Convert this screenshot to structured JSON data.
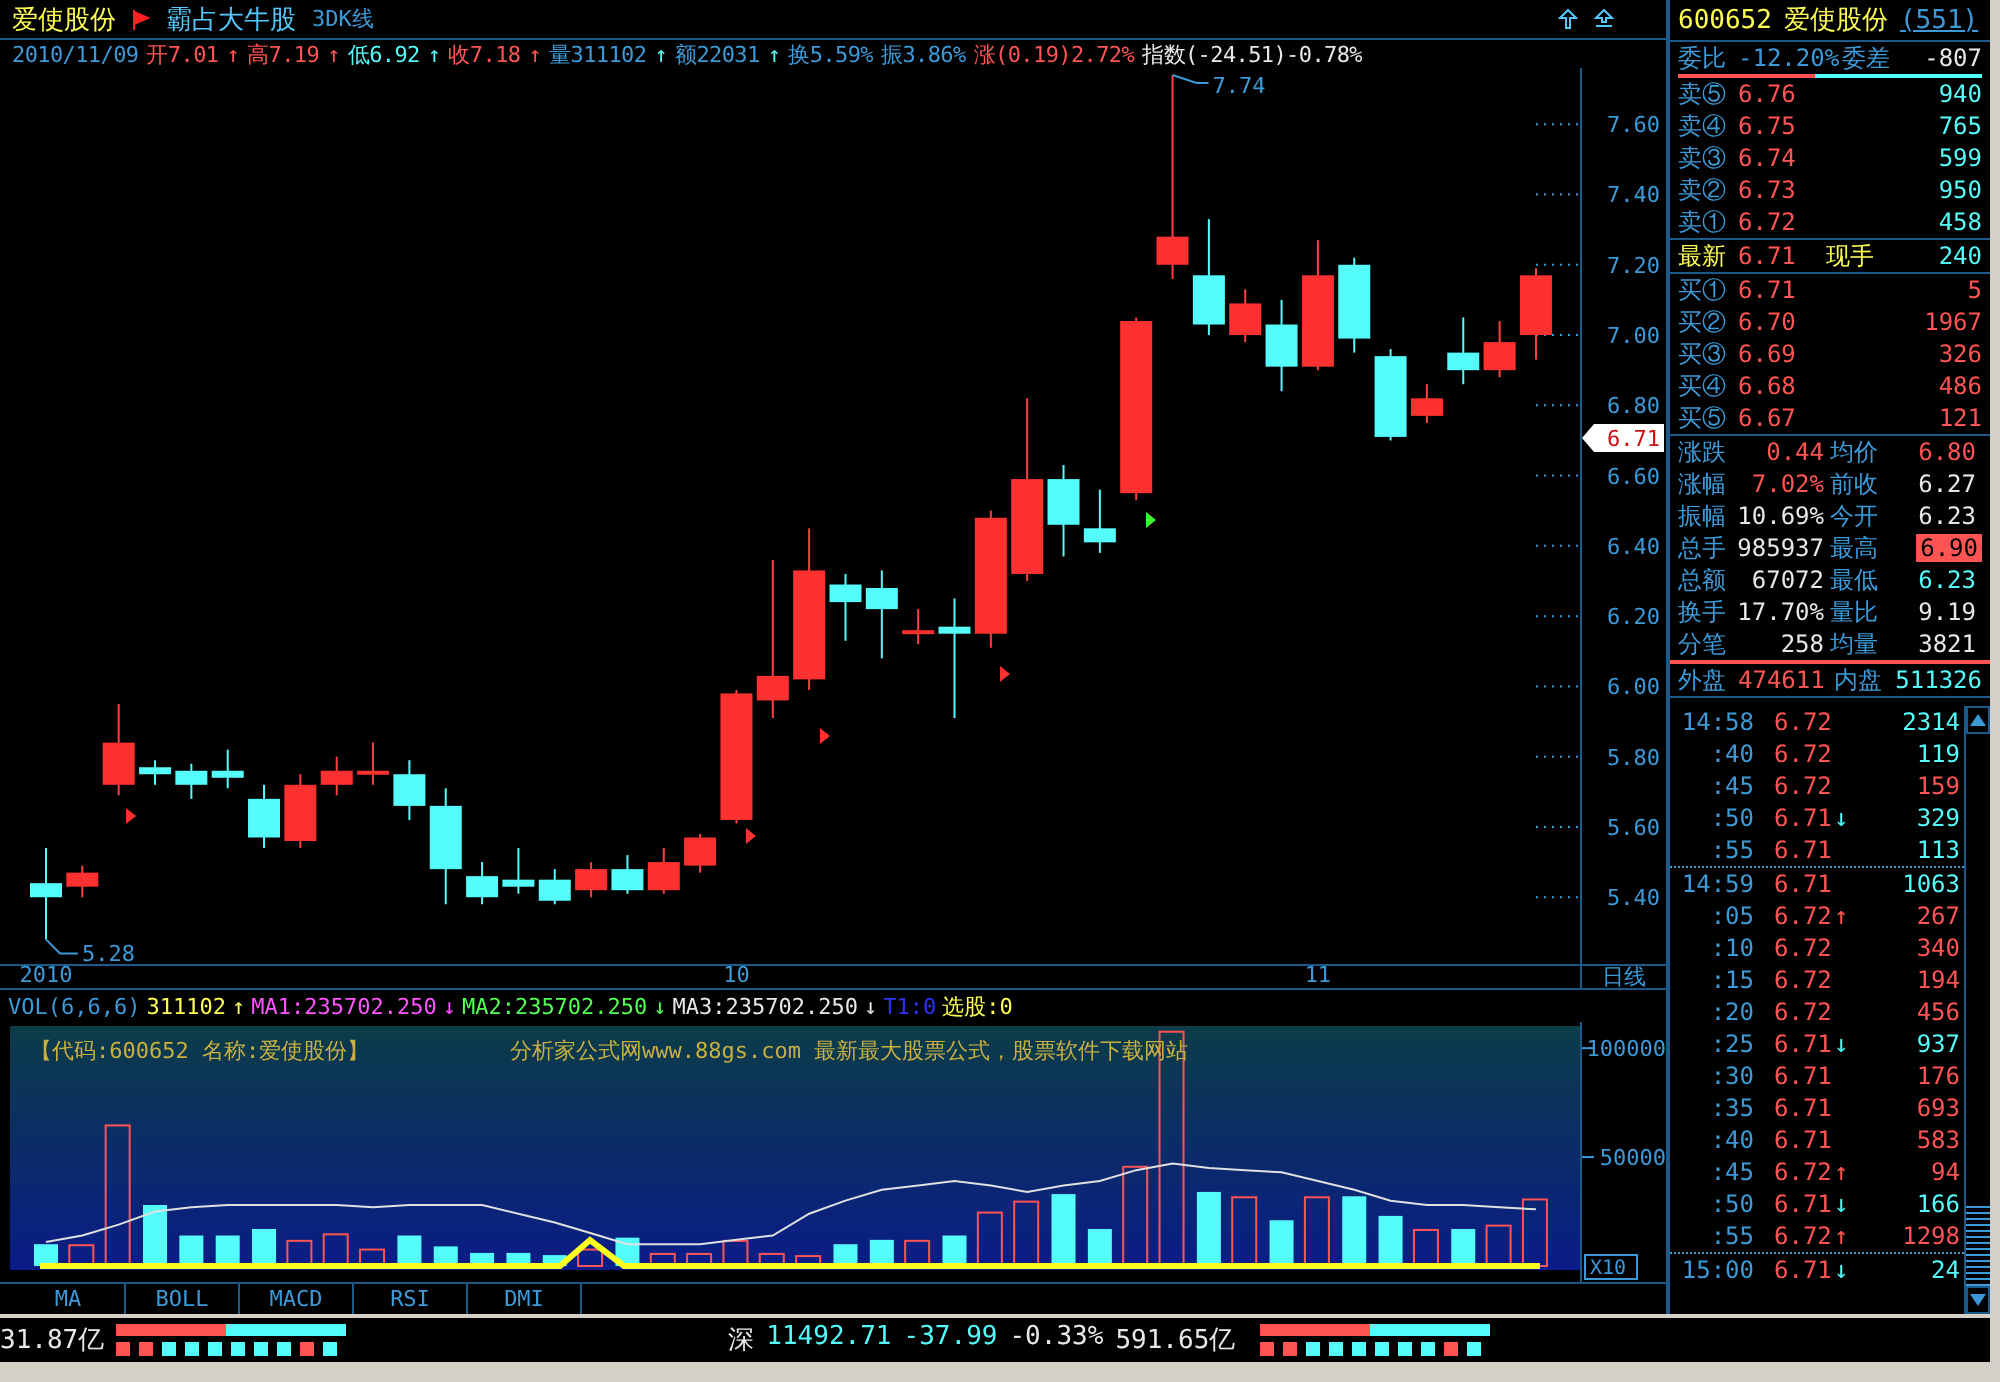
{
  "header": {
    "stock_name": "爱使股份",
    "formula": "霸占大牛股",
    "view": "3DK线"
  },
  "quote_line": [
    {
      "text": "2010/11/09",
      "color": "#3c9ad8"
    },
    {
      "text": "开7.01",
      "color": "#ff5454"
    },
    {
      "text": "↑",
      "color": "#ff5454"
    },
    {
      "text": "高7.19",
      "color": "#ff5454"
    },
    {
      "text": "↑",
      "color": "#ff5454"
    },
    {
      "text": "低6.92",
      "color": "#54fcfc"
    },
    {
      "text": "↑",
      "color": "#54fcfc"
    },
    {
      "text": "收7.18",
      "color": "#ff5454"
    },
    {
      "text": "↑",
      "color": "#ff5454"
    },
    {
      "text": "量311102",
      "color": "#3c9ad8"
    },
    {
      "text": "↑",
      "color": "#54fcfc"
    },
    {
      "text": "额22031",
      "color": "#3c9ad8"
    },
    {
      "text": "↑",
      "color": "#54fcfc"
    },
    {
      "text": "换5.59%",
      "color": "#3c9ad8"
    },
    {
      "text": "振3.86%",
      "color": "#3c9ad8"
    },
    {
      "text": "涨(0.19)2.72%",
      "color": "#ff5454"
    },
    {
      "text": "指数(-24.51)-0.78%",
      "color": "#e8e8e8"
    }
  ],
  "price_chart": {
    "high_label": "7.74",
    "low_label": "5.28",
    "current_price": "6.71",
    "chart_data": {
      "type": "candlestick",
      "categories": [
        "2010",
        null,
        null,
        null,
        null,
        null,
        null,
        null,
        null,
        null,
        null,
        null,
        null,
        null,
        null,
        null,
        null,
        null,
        null,
        "10",
        null,
        null,
        null,
        null,
        null,
        null,
        null,
        null,
        null,
        null,
        null,
        null,
        null,
        null,
        null,
        "11",
        null,
        null,
        null,
        null,
        null,
        null
      ],
      "ohlc": [
        [
          5.44,
          5.54,
          5.28,
          5.4
        ],
        [
          5.43,
          5.49,
          5.4,
          5.47
        ],
        [
          5.72,
          5.95,
          5.69,
          5.84
        ],
        [
          5.77,
          5.79,
          5.72,
          5.75
        ],
        [
          5.76,
          5.78,
          5.68,
          5.72
        ],
        [
          5.76,
          5.82,
          5.71,
          5.74
        ],
        [
          5.68,
          5.72,
          5.54,
          5.57
        ],
        [
          5.56,
          5.75,
          5.54,
          5.72
        ],
        [
          5.72,
          5.8,
          5.69,
          5.76
        ],
        [
          5.75,
          5.84,
          5.72,
          5.76
        ],
        [
          5.75,
          5.79,
          5.62,
          5.66
        ],
        [
          5.66,
          5.71,
          5.38,
          5.48
        ],
        [
          5.46,
          5.5,
          5.38,
          5.4
        ],
        [
          5.45,
          5.54,
          5.41,
          5.43
        ],
        [
          5.45,
          5.48,
          5.38,
          5.39
        ],
        [
          5.42,
          5.5,
          5.4,
          5.48
        ],
        [
          5.48,
          5.52,
          5.41,
          5.42
        ],
        [
          5.42,
          5.54,
          5.41,
          5.5
        ],
        [
          5.49,
          5.58,
          5.47,
          5.57
        ],
        [
          5.62,
          5.99,
          5.61,
          5.98
        ],
        [
          5.96,
          6.36,
          5.91,
          6.03
        ],
        [
          6.02,
          6.45,
          5.99,
          6.33
        ],
        [
          6.29,
          6.32,
          6.13,
          6.24
        ],
        [
          6.28,
          6.33,
          6.08,
          6.22
        ],
        [
          6.15,
          6.22,
          6.12,
          6.16
        ],
        [
          6.17,
          6.25,
          5.91,
          6.15
        ],
        [
          6.15,
          6.5,
          6.11,
          6.48
        ],
        [
          6.32,
          6.82,
          6.3,
          6.59
        ],
        [
          6.59,
          6.63,
          6.37,
          6.46
        ],
        [
          6.45,
          6.56,
          6.38,
          6.41
        ],
        [
          6.55,
          7.05,
          6.53,
          7.04
        ],
        [
          7.2,
          7.74,
          7.16,
          7.28
        ],
        [
          7.17,
          7.33,
          7.0,
          7.03
        ],
        [
          7.0,
          7.13,
          6.98,
          7.09
        ],
        [
          7.03,
          7.1,
          6.84,
          6.91
        ],
        [
          6.91,
          7.27,
          6.9,
          7.17
        ],
        [
          7.2,
          7.22,
          6.95,
          6.99
        ],
        [
          6.94,
          6.96,
          6.7,
          6.71
        ],
        [
          6.77,
          6.86,
          6.75,
          6.82
        ],
        [
          6.95,
          7.05,
          6.86,
          6.9
        ],
        [
          6.9,
          7.04,
          6.88,
          6.98
        ],
        [
          7.0,
          7.19,
          6.93,
          7.17
        ]
      ],
      "ylim": [
        5.21,
        7.76
      ],
      "yticks": [
        {
          "value": 7.6,
          "label": "7.60"
        },
        {
          "value": 7.4,
          "label": "7.40"
        },
        {
          "value": 7.2,
          "label": "7.20"
        },
        {
          "value": 7.0,
          "label": "7.00"
        },
        {
          "value": 6.8,
          "label": "6.80"
        },
        {
          "value": 6.6,
          "label": "6.60"
        },
        {
          "value": 6.4,
          "label": "6.40"
        },
        {
          "value": 6.2,
          "label": "6.20"
        },
        {
          "value": 6.0,
          "label": "6.00"
        },
        {
          "value": 5.8,
          "label": "5.80"
        },
        {
          "value": 5.6,
          "label": "5.60"
        },
        {
          "value": 5.4,
          "label": "5.40"
        }
      ]
    }
  },
  "x_axis": {
    "period": "日线"
  },
  "indicator_line": [
    {
      "text": "311102",
      "color": "#ffff54"
    },
    {
      "text": "↑",
      "color": "#ffff54"
    },
    {
      "text": "MA1:235702.250",
      "color": "#ff54ff"
    },
    {
      "text": "↓",
      "color": "#ff54ff"
    },
    {
      "text": "MA2:235702.250",
      "color": "#54ff54"
    },
    {
      "text": "↓",
      "color": "#54ff54"
    },
    {
      "text": "MA3:235702.250",
      "color": "#e8e8e8"
    },
    {
      "text": "↓",
      "color": "#e8e8e8"
    },
    {
      "text": "T1:0",
      "color": "#3030ff"
    },
    {
      "text": "选股:0",
      "color": "#ffff54"
    }
  ],
  "volume_panel": {
    "caption": "【代码:600652 名称:爱使股份】",
    "notice": "分析家公式网www.88gs.com 最新最大股票公式，股票软件下载网站",
    "scale": "X10",
    "chart_data": {
      "type": "bar",
      "categories": [
        null,
        null,
        null,
        null,
        null,
        null,
        null,
        null,
        null,
        null,
        null,
        null,
        null,
        null,
        null,
        null,
        null,
        null,
        null,
        null,
        null,
        null,
        null,
        null,
        null,
        null,
        null,
        null,
        null,
        null,
        null,
        null,
        null,
        null,
        null,
        null,
        null,
        null,
        null,
        null,
        null,
        null
      ],
      "series": [
        {
          "name": "VOL(6,6,6)",
          "colors": [
            "#54fcfc",
            "#ff5454",
            "#ff5454",
            "#54fcfc",
            "#54fcfc",
            "#54fcfc",
            "#54fcfc",
            "#ff5454",
            "#ff5454",
            "#ff5454",
            "#54fcfc",
            "#54fcfc",
            "#54fcfc",
            "#54fcfc",
            "#54fcfc",
            "#ff5454",
            "#54fcfc",
            "#ff5454",
            "#ff5454",
            "#ff5454",
            "#ff5454",
            "#ff5454",
            "#54fcfc",
            "#54fcfc",
            "#ff5454",
            "#54fcfc",
            "#ff5454",
            "#ff5454",
            "#54fcfc",
            "#54fcfc",
            "#ff5454",
            "#ff5454",
            "#54fcfc",
            "#ff5454",
            "#54fcfc",
            "#ff5454",
            "#54fcfc",
            "#54fcfc",
            "#ff5454",
            "#54fcfc",
            "#ff5454",
            "#ff5454"
          ],
          "values": [
            10000,
            10000,
            65000,
            28000,
            14000,
            14000,
            17000,
            12000,
            15000,
            8000,
            14000,
            9000,
            6000,
            6000,
            5000,
            8000,
            13000,
            6000,
            6000,
            12000,
            6000,
            5000,
            10000,
            12000,
            12000,
            14000,
            25000,
            30000,
            33000,
            17000,
            46000,
            108000,
            34000,
            32000,
            21000,
            32000,
            32000,
            23000,
            17000,
            17000,
            19000,
            31000
          ]
        },
        {
          "type": "line",
          "values": [
            11000,
            14000,
            19000,
            25000,
            27000,
            28000,
            28000,
            28000,
            28000,
            27000,
            28000,
            28000,
            28000,
            24000,
            20000,
            15000,
            10000,
            10000,
            10000,
            12000,
            14000,
            24000,
            30000,
            35000,
            37000,
            39000,
            37000,
            34000,
            37000,
            39000,
            44000,
            47000,
            45000,
            44000,
            43000,
            39000,
            35000,
            30000,
            28000,
            28000,
            27000,
            26000
          ]
        }
      ],
      "ylim": [
        0,
        112000
      ],
      "yticks": [
        {
          "value": 100000,
          "label": "100000"
        },
        {
          "value": 50000,
          "label": "50000"
        }
      ]
    }
  },
  "indicator_tabs": [
    {
      "label": "MA"
    },
    {
      "label": "BOLL"
    },
    {
      "label": "MACD"
    },
    {
      "label": "RSI"
    },
    {
      "label": "DMI"
    }
  ],
  "status_bar": {
    "left_amount": "31.87亿",
    "market": "深",
    "index": "11492.71",
    "change": "-37.99",
    "percent": "-0.33%",
    "amount": "591.65亿"
  },
  "quote_panel": {
    "code": "600652",
    "name": "爱使股份",
    "count": "(551)",
    "ratio_label": "委比",
    "ratio": "-12.20%",
    "diff_label": "委差",
    "diff": "-807",
    "asks": [
      {
        "label": "卖⑤",
        "price": "6.76",
        "volume": "940"
      },
      {
        "label": "卖④",
        "price": "6.75",
        "volume": "765"
      },
      {
        "label": "卖③",
        "price": "6.74",
        "volume": "599"
      },
      {
        "label": "卖②",
        "price": "6.73",
        "volume": "950"
      },
      {
        "label": "卖①",
        "price": "6.72",
        "volume": "458"
      }
    ],
    "last": {
      "label": "最新",
      "price": "6.71",
      "hand_label": "现手",
      "hand": "240"
    },
    "bids": [
      {
        "label": "买①",
        "price": "6.71",
        "volume": "5"
      },
      {
        "label": "买②",
        "price": "6.70",
        "volume": "1967"
      },
      {
        "label": "买③",
        "price": "6.69",
        "volume": "326"
      },
      {
        "label": "买④",
        "price": "6.68",
        "volume": "486"
      },
      {
        "label": "买⑤",
        "price": "6.67",
        "volume": "121"
      }
    ],
    "stats": [
      {
        "label": "涨跌",
        "value": "0.44",
        "color": "#ff5454",
        "highlight": false
      },
      {
        "label": "均价",
        "value": "6.80",
        "color": "#ff5454",
        "highlight": false
      },
      {
        "label": "涨幅",
        "value": "7.02%",
        "color": "#ff5454",
        "highlight": false
      },
      {
        "label": "前收",
        "value": "6.27",
        "color": "#e8e8e8",
        "highlight": false
      },
      {
        "label": "振幅",
        "value": "10.69%",
        "color": "#e8e8e8",
        "highlight": false
      },
      {
        "label": "今开",
        "value": "6.23",
        "color": "#e8e8e8",
        "highlight": false
      },
      {
        "label": "总手",
        "value": "985937",
        "color": "#e8e8e8",
        "highlight": false
      },
      {
        "label": "最高",
        "value": "6.90",
        "color": "#ff5454",
        "highlight": true
      },
      {
        "label": "总额",
        "value": "67072",
        "color": "#e8e8e8",
        "highlight": false
      },
      {
        "label": "最低",
        "value": "6.23",
        "color": "#54fcfc",
        "highlight": false
      },
      {
        "label": "换手",
        "value": "17.70%",
        "color": "#e8e8e8",
        "highlight": false
      },
      {
        "label": "量比",
        "value": "9.19",
        "color": "#e8e8e8",
        "highlight": false
      },
      {
        "label": "分笔",
        "value": "258",
        "color": "#e8e8e8",
        "highlight": false
      },
      {
        "label": "均量",
        "value": "3821",
        "color": "#e8e8e8",
        "highlight": false
      }
    ],
    "outer_label": "外盘",
    "outer": "474611",
    "inner_label": "内盘",
    "inner": "511326",
    "ticks": [
      {
        "time": "14:58",
        "price": "6.72",
        "volume": "2314",
        "color": "#54fcfc",
        "new_minute": false
      },
      {
        "time": ":40",
        "price": "6.72",
        "volume": "119",
        "color": "#54fcfc",
        "new_minute": false
      },
      {
        "time": ":45",
        "price": "6.72",
        "volume": "159",
        "color": "#ff5454",
        "new_minute": false
      },
      {
        "time": ":50",
        "price": "6.71",
        "arrow": "↓",
        "volume": "329",
        "color": "#54fcfc",
        "new_minute": false
      },
      {
        "time": ":55",
        "price": "6.71",
        "volume": "113",
        "color": "#54fcfc",
        "new_minute": false
      },
      {
        "time": "14:59",
        "price": "6.71",
        "volume": "1063",
        "color": "#54fcfc",
        "new_minute": true
      },
      {
        "time": ":05",
        "price": "6.72",
        "arrow": "↑",
        "volume": "267",
        "color": "#ff5454",
        "new_minute": false
      },
      {
        "time": ":10",
        "price": "6.72",
        "volume": "340",
        "color": "#ff5454",
        "new_minute": false
      },
      {
        "time": ":15",
        "price": "6.72",
        "volume": "194",
        "color": "#ff5454",
        "new_minute": false
      },
      {
        "time": ":20",
        "price": "6.72",
        "volume": "456",
        "color": "#ff5454",
        "new_minute": false
      },
      {
        "time": ":25",
        "price": "6.71",
        "arrow": "↓",
        "volume": "937",
        "color": "#54fcfc",
        "new_minute": false
      },
      {
        "time": ":30",
        "price": "6.71",
        "volume": "176",
        "color": "#ff5454",
        "new_minute": false
      },
      {
        "time": ":35",
        "price": "6.71",
        "volume": "693",
        "color": "#ff5454",
        "new_minute": false
      },
      {
        "time": ":40",
        "price": "6.71",
        "volume": "583",
        "color": "#ff5454",
        "new_minute": false
      },
      {
        "time": ":45",
        "price": "6.72",
        "arrow": "↑",
        "volume": "94",
        "color": "#ff5454",
        "new_minute": false
      },
      {
        "time": ":50",
        "price": "6.71",
        "arrow": "↓",
        "volume": "166",
        "color": "#54fcfc",
        "new_minute": false
      },
      {
        "time": ":55",
        "price": "6.72",
        "arrow": "↑",
        "volume": "1298",
        "color": "#ff5454",
        "new_minute": false
      },
      {
        "time": "15:00",
        "price": "6.71",
        "arrow": "↓",
        "volume": "24",
        "color": "#54fcfc",
        "new_minute": true
      }
    ]
  }
}
